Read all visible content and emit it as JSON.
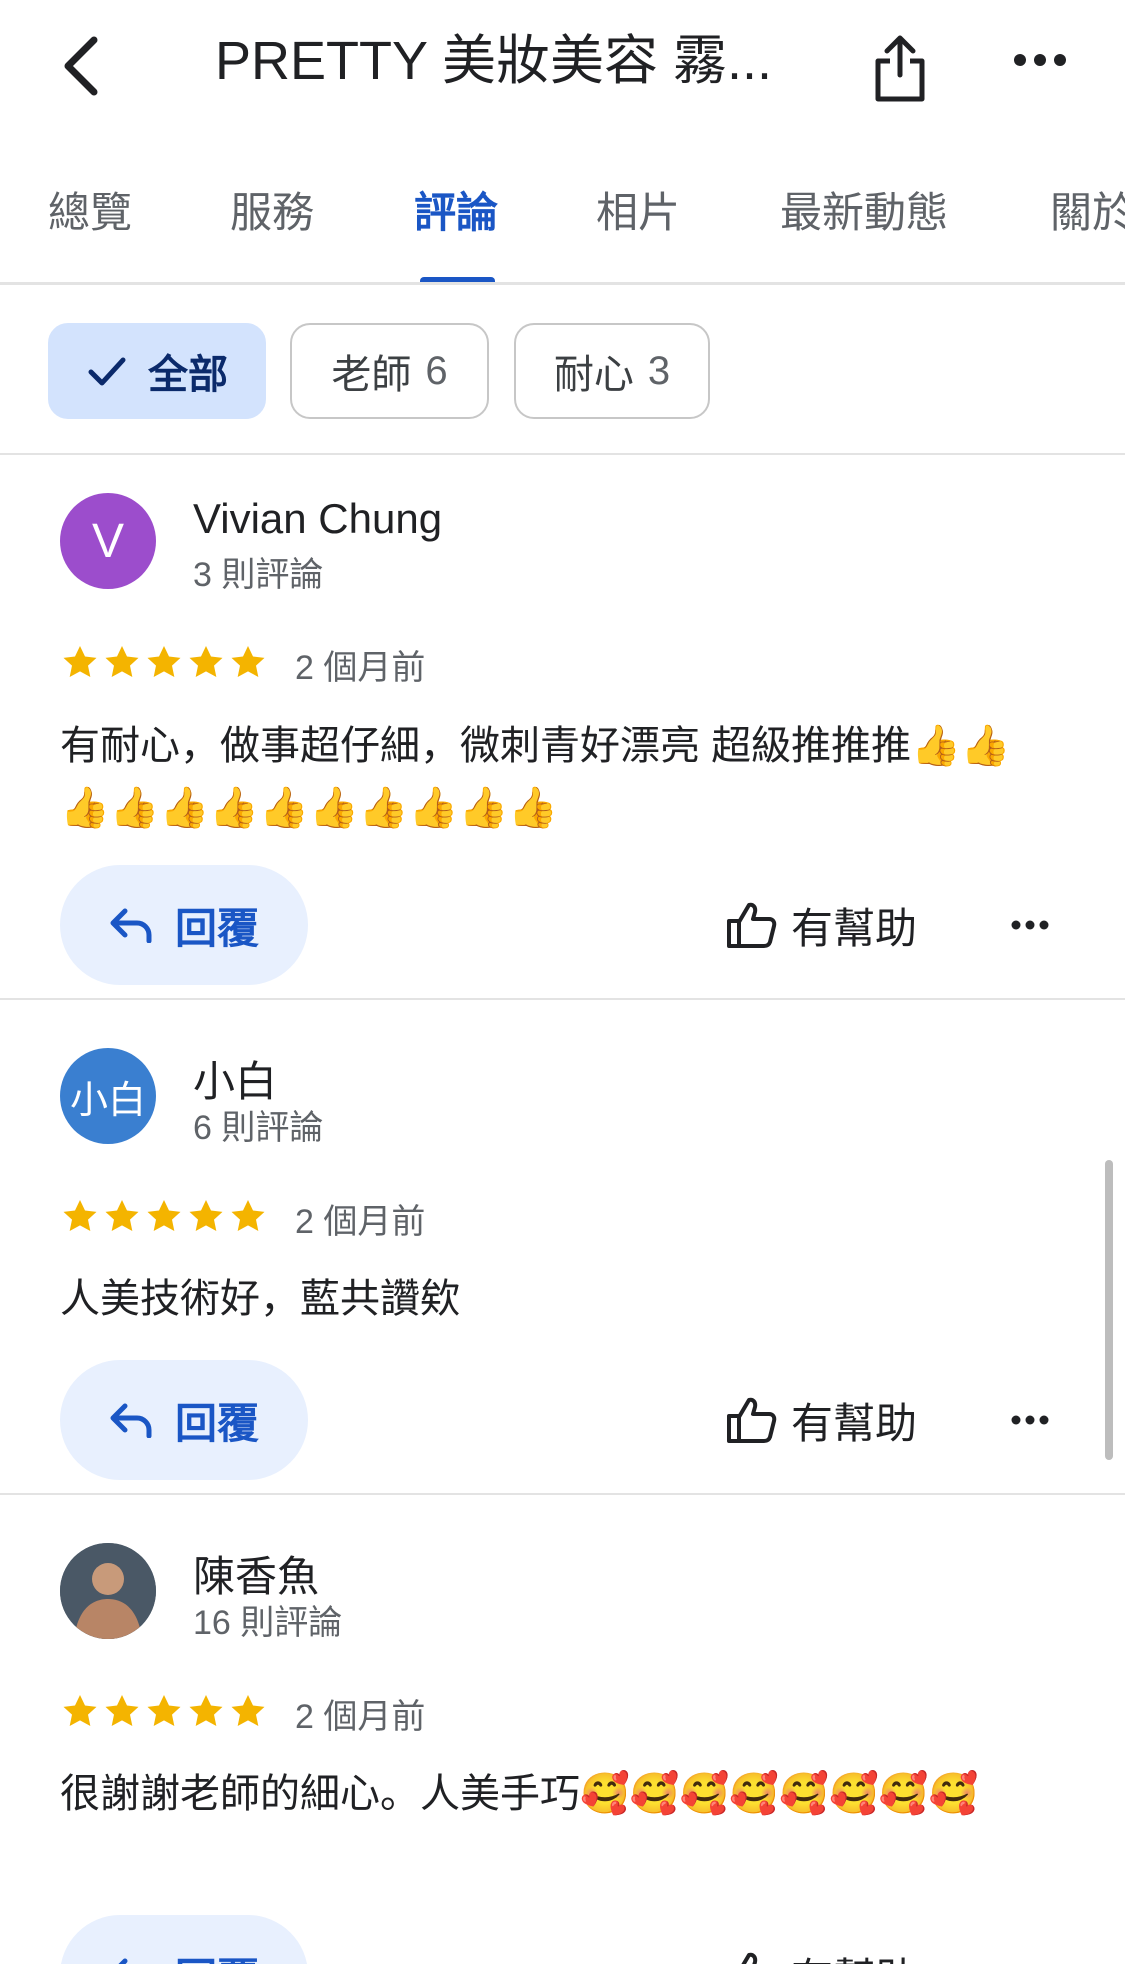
{
  "header": {
    "title": "PRETTY 美妝美容 霧...",
    "back_icon": "chevron-left-icon",
    "share_icon": "share-icon",
    "more_icon": "more-horizontal-icon"
  },
  "tabs": [
    {
      "label": "總覽"
    },
    {
      "label": "服務"
    },
    {
      "label": "評論",
      "active": true
    },
    {
      "label": "相片"
    },
    {
      "label": "最新動態"
    },
    {
      "label": "關於"
    }
  ],
  "filters": {
    "chips": [
      {
        "label": "全部",
        "count": "",
        "selected": true
      },
      {
        "label": "老師",
        "count": "6"
      },
      {
        "label": "耐心",
        "count": "3"
      }
    ]
  },
  "colors": {
    "accent": "#1a56c5",
    "star": "#f4b400",
    "avatar_v": "#9c4dcc",
    "avatar_xb": "#3a7fd0"
  },
  "reviews": [
    {
      "author": "Vivian Chung",
      "avatar_text": "V",
      "review_count": "3 則評論",
      "rating": 5,
      "date": "2 個月前",
      "text": "有耐心，做事超仔細，微刺青好漂亮 超級推推推👍👍👍👍👍👍👍👍👍👍👍👍",
      "reply_label": "回覆",
      "helpful_label": "有幫助"
    },
    {
      "author": "小白",
      "avatar_text": "小白",
      "review_count": "6 則評論",
      "rating": 5,
      "date": "2 個月前",
      "text": "人美技術好，藍共讚欸",
      "reply_label": "回覆",
      "helpful_label": "有幫助"
    },
    {
      "author": "陳香魚",
      "avatar_text": "",
      "review_count": "16 則評論",
      "rating": 5,
      "date": "2 個月前",
      "text": "很謝謝老師的細心。人美手巧🥰🥰🥰🥰🥰🥰🥰🥰",
      "reply_label": "回覆",
      "helpful_label": "有幫助"
    }
  ]
}
